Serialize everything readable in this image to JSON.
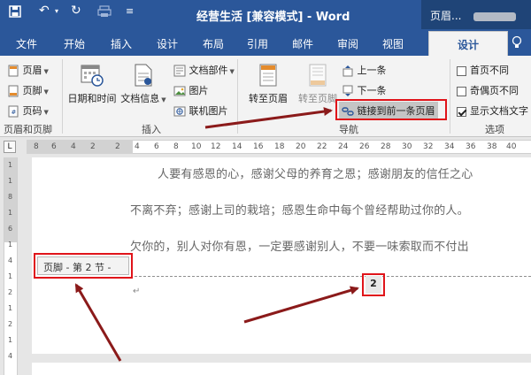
{
  "window": {
    "title": "经营生活 [兼容模式] - Word",
    "context_tab_label": "页眉..."
  },
  "tabs": [
    {
      "label": "文件"
    },
    {
      "label": "开始"
    },
    {
      "label": "插入"
    },
    {
      "label": "设计"
    },
    {
      "label": "布局"
    },
    {
      "label": "引用"
    },
    {
      "label": "邮件"
    },
    {
      "label": "审阅"
    },
    {
      "label": "视图"
    },
    {
      "label": "设计",
      "active": true
    }
  ],
  "ribbon": {
    "header_footer": {
      "header": "页眉",
      "footer": "页脚",
      "page_number": "页码",
      "group_label": "页眉和页脚"
    },
    "insert": {
      "date_time": "日期和时间",
      "doc_info": "文档信息",
      "doc_parts": "文档部件",
      "picture": "图片",
      "online_picture": "联机图片",
      "group_label": "插入"
    },
    "navigation": {
      "goto_header": "转至页眉",
      "goto_footer": "转至页脚",
      "previous": "上一条",
      "next": "下一条",
      "link_to_previous": "链接到前一条页眉",
      "group_label": "导航"
    },
    "options": {
      "first_page_diff": "首页不同",
      "first_page_diff_checked": false,
      "odd_even_diff": "奇偶页不同",
      "odd_even_diff_checked": false,
      "show_doc_text": "显示文档文字",
      "show_doc_text_checked": true,
      "group_label": "选项"
    }
  },
  "ruler": {
    "h_ticks": [
      "8",
      "6",
      "4",
      "2",
      "2",
      "4",
      "6",
      "8",
      "10",
      "12",
      "14",
      "16",
      "18",
      "20",
      "22",
      "24",
      "26",
      "28",
      "30",
      "32",
      "34",
      "36",
      "38",
      "40",
      "42",
      "44",
      "46"
    ],
    "v_ticks": [
      "1",
      "1",
      "8",
      "1",
      "6",
      "1",
      "4",
      "1",
      "2",
      "1",
      "2",
      "1",
      "4"
    ]
  },
  "document": {
    "lines": [
      "人要有感恩的心，感谢父母的养育之恩；感谢朋友的信任之心",
      "不离不弃；感谢上司的栽培；感恩生命中每个曾经帮助过你的人。",
      "欠你的，别人对你有恩，一定要感谢别人，不要一味索取而不付出"
    ],
    "footer_label": "页脚 - 第 2 节 -",
    "page_number": "2"
  },
  "colors": {
    "titlebar": "#2b579a",
    "ribbon_bg": "#f3f3f3",
    "highlight": "#e0141a",
    "arrow": "#8b1a1a"
  }
}
